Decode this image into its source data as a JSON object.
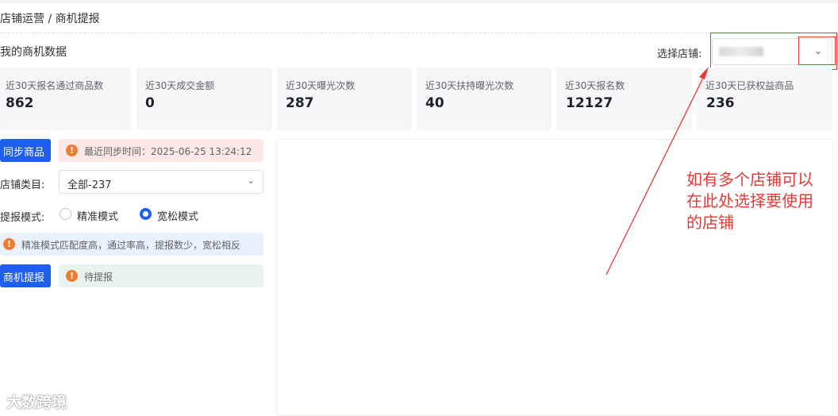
{
  "breadcrumb": "店铺运营 / 商机提报",
  "section_title": "我的商机数据",
  "store_picker": {
    "label": "选择店铺:"
  },
  "stats": [
    {
      "label": "近30天报名通过商品数",
      "value": "862"
    },
    {
      "label": "近30天成交金额",
      "value": "0"
    },
    {
      "label": "近30天曝光次数",
      "value": "287"
    },
    {
      "label": "近30天扶持曝光次数",
      "value": "40"
    },
    {
      "label": "近30天报名数",
      "value": "12127"
    },
    {
      "label": "近30天已获权益商品",
      "value": "236"
    }
  ],
  "sync": {
    "button": "同步商品",
    "alert": "最近同步时间：2025-06-25 13:24:12"
  },
  "category": {
    "label": "店铺类目:",
    "value": "全部-237"
  },
  "mode": {
    "label": "提报模式:",
    "options": [
      {
        "label": "精准模式",
        "selected": false
      },
      {
        "label": "宽松模式",
        "selected": true
      }
    ],
    "tip": "精准模式匹配度高，通过率高，提报数少，宽松相反"
  },
  "submit": {
    "button": "商机提报",
    "status": "待提报"
  },
  "annotation": {
    "lines": [
      "如有多个店铺可以",
      "在此处选择要使用",
      "的店铺"
    ]
  },
  "watermark": "大数跨境",
  "icons": {
    "alert": "exclamation-circle-icon",
    "caret": "chevron-down-icon"
  },
  "colors": {
    "primary": "#1e5ff0",
    "warning": "#f07c31",
    "annotation": "#e53935"
  }
}
